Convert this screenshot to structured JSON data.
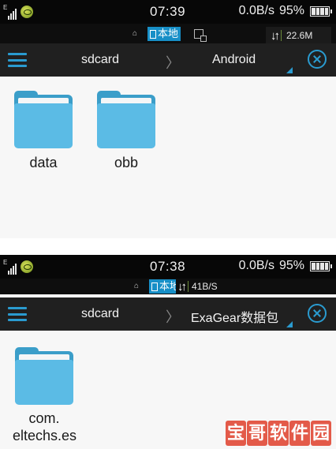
{
  "screens": [
    {
      "status": {
        "time": "07:39",
        "speed": "0.0B/s",
        "battery": "95%"
      },
      "subbar": {
        "local_label": "本地",
        "transfer_text": "22.6M"
      },
      "toolbar": {
        "crumb_root": "sdcard",
        "crumb_sep": "〉",
        "crumb_current": "Android"
      },
      "folders": [
        {
          "name": "data"
        },
        {
          "name": "obb"
        }
      ]
    },
    {
      "status": {
        "time": "07:38",
        "speed": "0.0B/s",
        "battery": "95%"
      },
      "subbar": {
        "local_label": "本地",
        "transfer_text": "41B/S"
      },
      "toolbar": {
        "crumb_root": "sdcard",
        "crumb_sep": "〉",
        "crumb_current": "ExaGear数据包"
      },
      "folders": [
        {
          "name_line1": "com.",
          "name_line2": "eltechs.es"
        }
      ]
    }
  ],
  "watermark": [
    "宝",
    "哥",
    "软",
    "件",
    "园"
  ],
  "colors": {
    "accent": "#2a9bd0",
    "folder": "#5bbbe5",
    "local_chip": "#178fc7",
    "watermark": "#e24d3b"
  },
  "icons": [
    "signal-icon",
    "globe-icon",
    "battery-icon",
    "home-icon",
    "tab-icon",
    "network-icon",
    "transfer-icon",
    "menu-icon",
    "dropdown-icon",
    "close-icon",
    "folder-icon"
  ]
}
